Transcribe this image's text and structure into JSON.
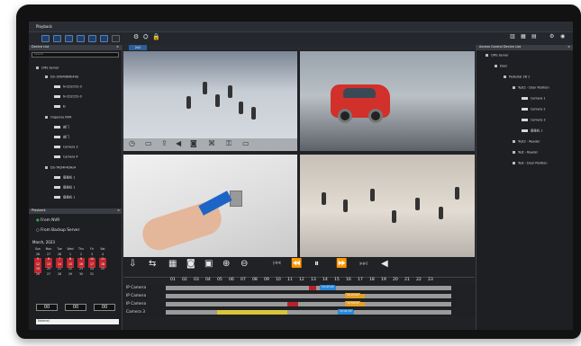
{
  "window": {
    "title": "Playback"
  },
  "toolbar": {
    "right_icons": [
      "grid-icon",
      "grid-icon",
      "grid-icon",
      "gear-icon",
      "user-icon"
    ]
  },
  "left_panel": {
    "device_list_title": "Device List",
    "search_placeholder": "Search",
    "tree": [
      {
        "label": "CMS Server"
      },
      {
        "label": "DS-10W4984E4HS"
      },
      {
        "label": "N-CD2152-0"
      },
      {
        "label": "N-CD2152-0"
      },
      {
        "label": "Ð"
      },
      {
        "label": "Organise NVR"
      },
      {
        "label": "部门"
      },
      {
        "label": "部门"
      },
      {
        "label": "Camera 3"
      },
      {
        "label": "Camera 4"
      },
      {
        "label": "DS-7RD4F4DAs4"
      },
      {
        "label": "摄像机 1"
      },
      {
        "label": "摄像机 1"
      },
      {
        "label": "摄像机 1"
      }
    ],
    "source_options": [
      {
        "label": "From NVR",
        "selected": true
      },
      {
        "label": "From Backup Server",
        "selected": false
      }
    ],
    "playback_label": "Playback",
    "calendar": {
      "month": "March, 2023",
      "weekdays": [
        "Sun",
        "Mon",
        "Tue",
        "Wed",
        "Thu",
        "Fri",
        "Sat"
      ],
      "weeks": [
        [
          "26",
          "27",
          "28",
          "1",
          "2",
          "3",
          "4"
        ],
        [
          "5",
          "6",
          "7",
          "8",
          "9",
          "10",
          "11"
        ],
        [
          "12",
          "13",
          "14",
          "15",
          "16",
          "17",
          "18"
        ],
        [
          "19",
          "20",
          "21",
          "22",
          "23",
          "24",
          "25"
        ],
        [
          "26",
          "27",
          "28",
          "29",
          "30",
          "31",
          ""
        ]
      ]
    },
    "time": [
      "00",
      "00",
      "00"
    ],
    "mode": "Normal"
  },
  "right_panel": {
    "title": "Access Control Device List",
    "tree": [
      {
        "label": "CMS Server"
      },
      {
        "label": "Door"
      },
      {
        "label": "Pedestal 2B 1"
      },
      {
        "label": "Test2 - Door Position"
      },
      {
        "label": "Camera 1"
      },
      {
        "label": "Camera 2"
      },
      {
        "label": "Camera 3"
      },
      {
        "label": "摄像机 1"
      },
      {
        "label": "Test2 - Reader"
      },
      {
        "label": "Test - Reader"
      },
      {
        "label": "Test - Door Position"
      }
    ]
  },
  "video_tab": {
    "label": "2x2"
  },
  "controls": {
    "icons": [
      "export-icon",
      "sync-icon",
      "calendar-icon",
      "camera-icon",
      "clip-icon",
      "zoom-in-icon",
      "zoom-out-icon",
      "skip-back-icon",
      "rewind-icon",
      "pause-icon",
      "fast-forward-icon",
      "skip-forward-icon",
      "reverse-play-icon"
    ]
  },
  "timeline": {
    "hours": [
      "01",
      "02",
      "03",
      "04",
      "05",
      "06",
      "07",
      "08",
      "09",
      "10",
      "11",
      "12",
      "13",
      "14",
      "15",
      "16",
      "17",
      "18",
      "19",
      "20",
      "21",
      "22",
      "23"
    ],
    "tracks": [
      {
        "label": "IP Camera",
        "tag": "13:47:22"
      },
      {
        "label": "IP Camera",
        "tag": "15:23:40"
      },
      {
        "label": "IP Camera",
        "tag": "15:58:34"
      },
      {
        "label": "Camera 3",
        "tag": "13:41:33"
      }
    ]
  }
}
